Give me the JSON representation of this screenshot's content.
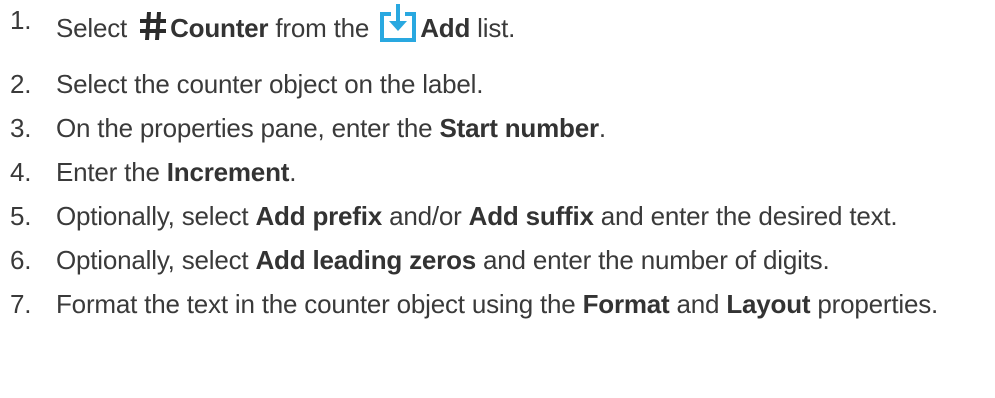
{
  "steps": [
    {
      "number": "1.",
      "parts": {
        "a": "Select ",
        "counter_label": "Counter",
        "b": " from the ",
        "add_label": "Add",
        "c": " list."
      },
      "icons": [
        "hash-icon",
        "add-list-icon"
      ]
    },
    {
      "number": "2.",
      "text": "Select the counter object on the label."
    },
    {
      "number": "3.",
      "parts": {
        "a": "On the properties pane, enter the ",
        "bold": "Start number",
        "b": "."
      }
    },
    {
      "number": "4.",
      "parts": {
        "a": "Enter the ",
        "bold": "Increment",
        "b": "."
      }
    },
    {
      "number": "5.",
      "parts": {
        "a": "Optionally, select ",
        "bold1": "Add prefix",
        "b": " and/or ",
        "bold2": "Add suffix",
        "c": " and enter the desired text."
      }
    },
    {
      "number": "6.",
      "parts": {
        "a": "Optionally, select ",
        "bold": "Add leading zeros",
        "b": " and enter the number of digits."
      }
    },
    {
      "number": "7.",
      "parts": {
        "a": "Format the text in the counter object using the ",
        "bold1": "Format",
        "b": " and ",
        "bold2": "Layout",
        "c": " properties."
      }
    }
  ],
  "colors": {
    "text": "#3a3a3a",
    "hash_icon": "#2b2b2b",
    "add_icon_blue": "#29a8e0"
  }
}
